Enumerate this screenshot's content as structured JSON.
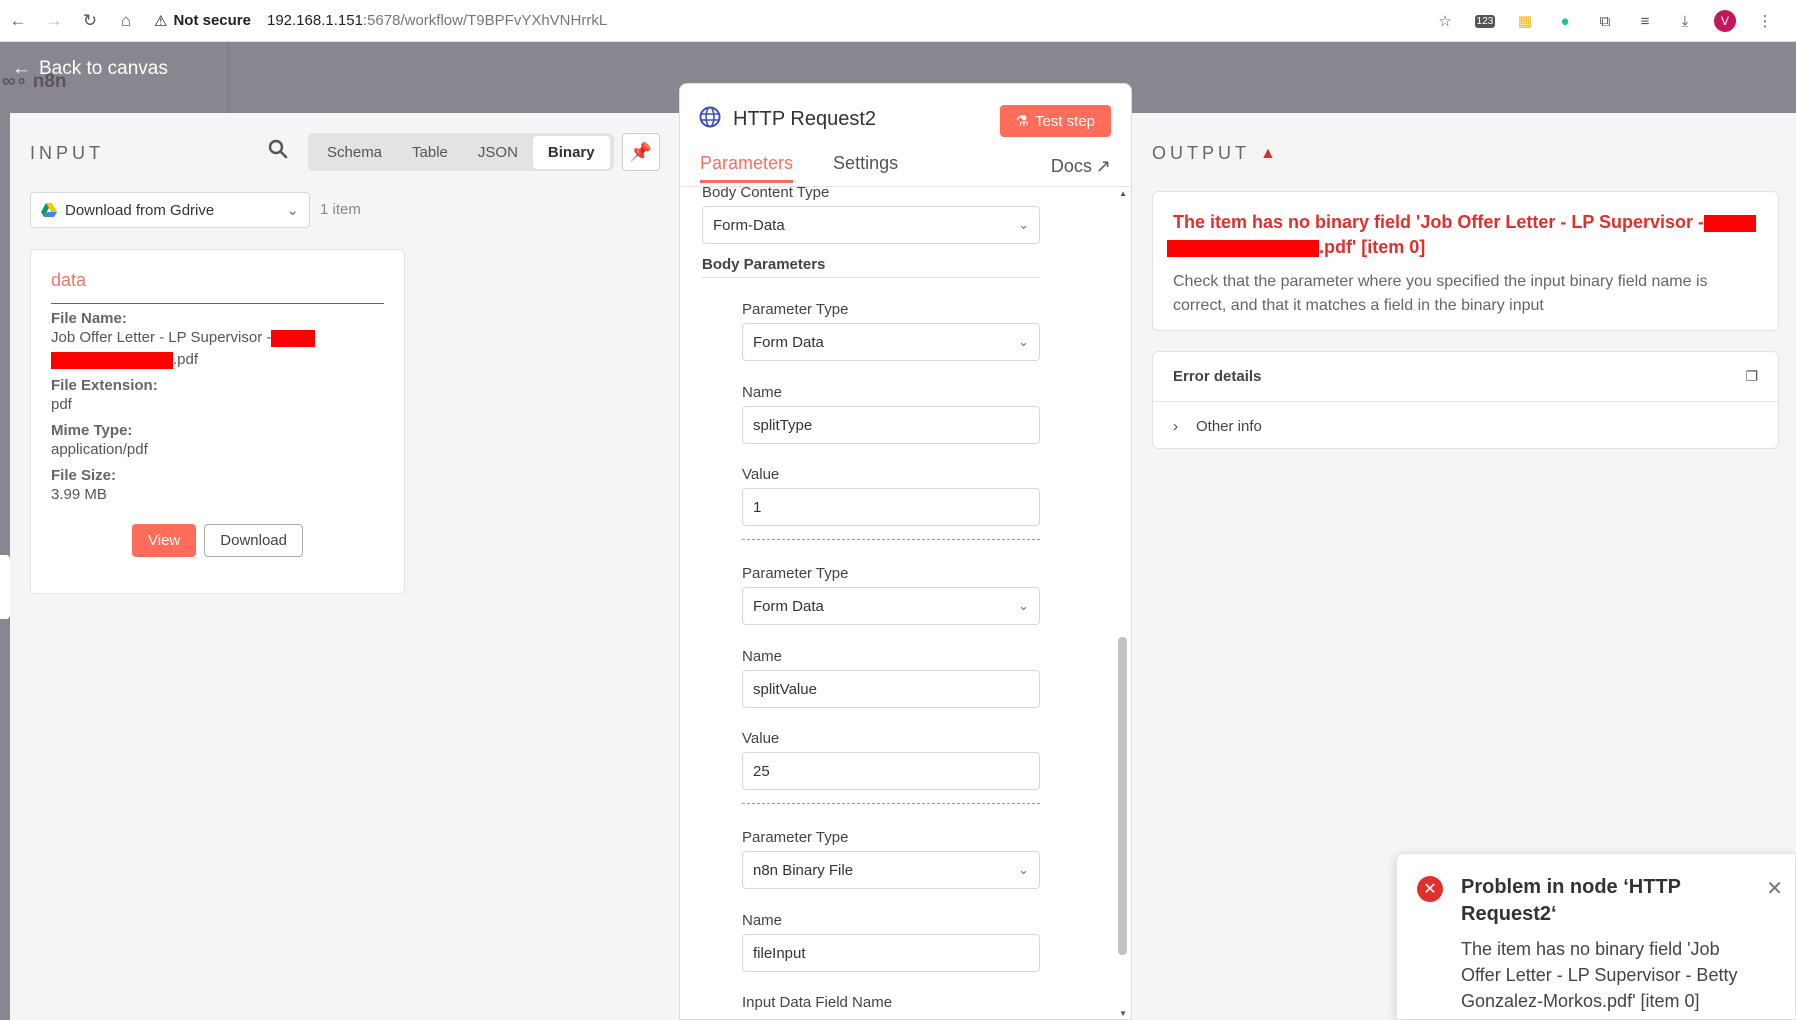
{
  "browser": {
    "secure_label": "Not secure",
    "url_host": "192.168.1.151",
    "url_rest": ":5678/workflow/T9BPFvYXhVNHrrkL",
    "ext_badge": "123",
    "avatar_letter": "V"
  },
  "header": {
    "back_label": "Back to canvas",
    "logo": "n8n"
  },
  "input": {
    "title": "INPUT",
    "tabs": [
      {
        "label": "Schema"
      },
      {
        "label": "Table"
      },
      {
        "label": "JSON"
      },
      {
        "label": "Binary"
      }
    ],
    "active_tab": "Binary",
    "node_select": "Download from Gdrive",
    "items_count": "1 item",
    "card": {
      "title": "data",
      "file_name_label": "File Name:",
      "file_name_part1": "Job Offer Letter - LP Supervisor -",
      "file_name_part2": ".pdf",
      "file_ext_label": "File Extension:",
      "file_ext": "pdf",
      "mime_label": "Mime Type:",
      "mime": "application/pdf",
      "size_label": "File Size:",
      "size": "3.99 MB",
      "view_label": "View",
      "download_label": "Download"
    }
  },
  "params": {
    "node_title": "HTTP Request2",
    "test_label": "Test step",
    "tabs": [
      {
        "label": "Parameters"
      },
      {
        "label": "Settings"
      }
    ],
    "docs_label": "Docs",
    "body_content_type_label": "Body Content Type",
    "body_content_type": "Form-Data",
    "body_params_title": "Body Parameters",
    "entries": [
      {
        "type_label": "Parameter Type",
        "type": "Form Data",
        "name_label": "Name",
        "name": "splitType",
        "value_label": "Value",
        "value": "1"
      },
      {
        "type_label": "Parameter Type",
        "type": "Form Data",
        "name_label": "Name",
        "name": "splitValue",
        "value_label": "Value",
        "value": "25"
      },
      {
        "type_label": "Parameter Type",
        "type": "n8n Binary File",
        "name_label": "Name",
        "name": "fileInput",
        "value_label": "Input Data Field Name"
      }
    ]
  },
  "output": {
    "title": "OUTPUT",
    "error_title_part1": "The item has no binary field 'Job Offer Letter - LP Supervisor -",
    "error_title_part2": ".pdf' [item 0]",
    "error_desc": "Check that the parameter where you specified the input binary field name is correct, and that it matches a field in the binary input",
    "details_title": "Error details",
    "other_info": "Other info"
  },
  "toast": {
    "title": "Problem in node ‘HTTP Request2‘",
    "message": "The item has no binary field 'Job Offer Letter - LP Supervisor - Betty Gonzalez-Morkos.pdf' [item 0]"
  },
  "colors": {
    "accent": "#ff6d5a",
    "error": "#e0302c",
    "redaction": "#ff0000"
  }
}
